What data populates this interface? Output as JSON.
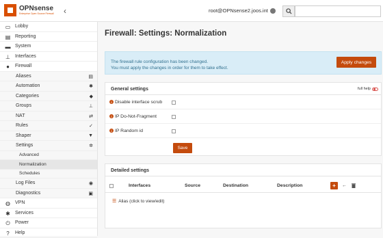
{
  "header": {
    "logo_name": "OPNsense",
    "logo_tagline": "Enterprise Open Source Firewall",
    "user": "root@OPNsense2.joos.int"
  },
  "sidebar": {
    "top_items": [
      {
        "label": "Lobby",
        "icon": "laptop-icon"
      },
      {
        "label": "Reporting",
        "icon": "report-icon"
      },
      {
        "label": "System",
        "icon": "server-icon"
      },
      {
        "label": "Interfaces",
        "icon": "sitemap-icon"
      },
      {
        "label": "Firewall",
        "icon": "fire-icon"
      }
    ],
    "firewall_items": [
      {
        "label": "Aliases",
        "icon": "list-icon"
      },
      {
        "label": "Automation",
        "icon": "gear-icon"
      },
      {
        "label": "Categories",
        "icon": "tags-icon"
      },
      {
        "label": "Groups",
        "icon": "sitemap-icon"
      },
      {
        "label": "NAT",
        "icon": "exchange-icon"
      },
      {
        "label": "Rules",
        "icon": "check-icon"
      },
      {
        "label": "Shaper",
        "icon": "filter-icon"
      },
      {
        "label": "Settings",
        "icon": "cogs-icon"
      }
    ],
    "settings_items": [
      {
        "label": "Advanced"
      },
      {
        "label": "Normalization"
      },
      {
        "label": "Schedules"
      }
    ],
    "after_items": [
      {
        "label": "Log Files",
        "icon": "eye-icon"
      },
      {
        "label": "Diagnostics",
        "icon": "medkit-icon"
      }
    ],
    "bottom_items": [
      {
        "label": "VPN",
        "icon": "globe-icon"
      },
      {
        "label": "Services",
        "icon": "cog-icon"
      },
      {
        "label": "Power",
        "icon": "plug-icon"
      },
      {
        "label": "Help",
        "icon": "help-icon"
      }
    ]
  },
  "main": {
    "title": "Firewall: Settings: Normalization",
    "alert_line1": "The firewall rule configuration has been changed.",
    "alert_line2": "You must apply the changes in order for them to take effect.",
    "apply_label": "Apply changes"
  },
  "general": {
    "title": "General settings",
    "full_help": "full help",
    "rows": [
      {
        "label": "Disable interface scrub"
      },
      {
        "label": "IP Do-Not-Fragment"
      },
      {
        "label": "IP Random id"
      }
    ],
    "save_label": "Save"
  },
  "detailed": {
    "title": "Detailed settings",
    "columns": [
      "Interfaces",
      "Source",
      "Destination",
      "Description"
    ],
    "alias_link": "Alias (click to view/edit)"
  },
  "colors": {
    "accent": "#c44b0d",
    "alert_bg": "#d9edf7",
    "alert_text": "#31708f"
  }
}
